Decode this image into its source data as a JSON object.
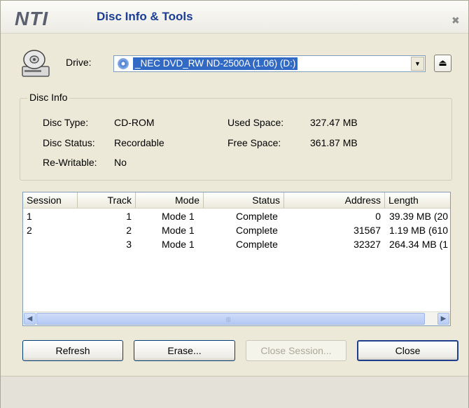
{
  "window": {
    "logo": "NTI",
    "title": "Disc Info & Tools",
    "close_glyph": "✖"
  },
  "drive": {
    "label": "Drive:",
    "selected": "_NEC DVD_RW ND-2500A (1.06) (D:)",
    "eject_glyph": "⏏"
  },
  "disc_info": {
    "group_title": "Disc Info",
    "disc_type_label": "Disc Type:",
    "disc_type": "CD-ROM",
    "disc_status_label": "Disc Status:",
    "disc_status": "Recordable",
    "rewritable_label": "Re-Writable:",
    "rewritable": "No",
    "used_space_label": "Used Space:",
    "used_space": "327.47 MB",
    "free_space_label": "Free Space:",
    "free_space": "361.87 MB"
  },
  "table": {
    "columns": [
      "Session",
      "Track",
      "Mode",
      "Status",
      "Address",
      "Length"
    ],
    "rows": [
      {
        "session": "1",
        "track": "1",
        "mode": "Mode 1",
        "status": "Complete",
        "address": "0",
        "length": "39.39 MB (20"
      },
      {
        "session": "2",
        "track": "2",
        "mode": "Mode 1",
        "status": "Complete",
        "address": "31567",
        "length": "1.19 MB (610"
      },
      {
        "session": "",
        "track": "3",
        "mode": "Mode 1",
        "status": "Complete",
        "address": "32327",
        "length": "264.34 MB (1"
      }
    ]
  },
  "buttons": {
    "refresh": "Refresh",
    "erase": "Erase...",
    "close_session": "Close Session...",
    "close": "Close"
  }
}
